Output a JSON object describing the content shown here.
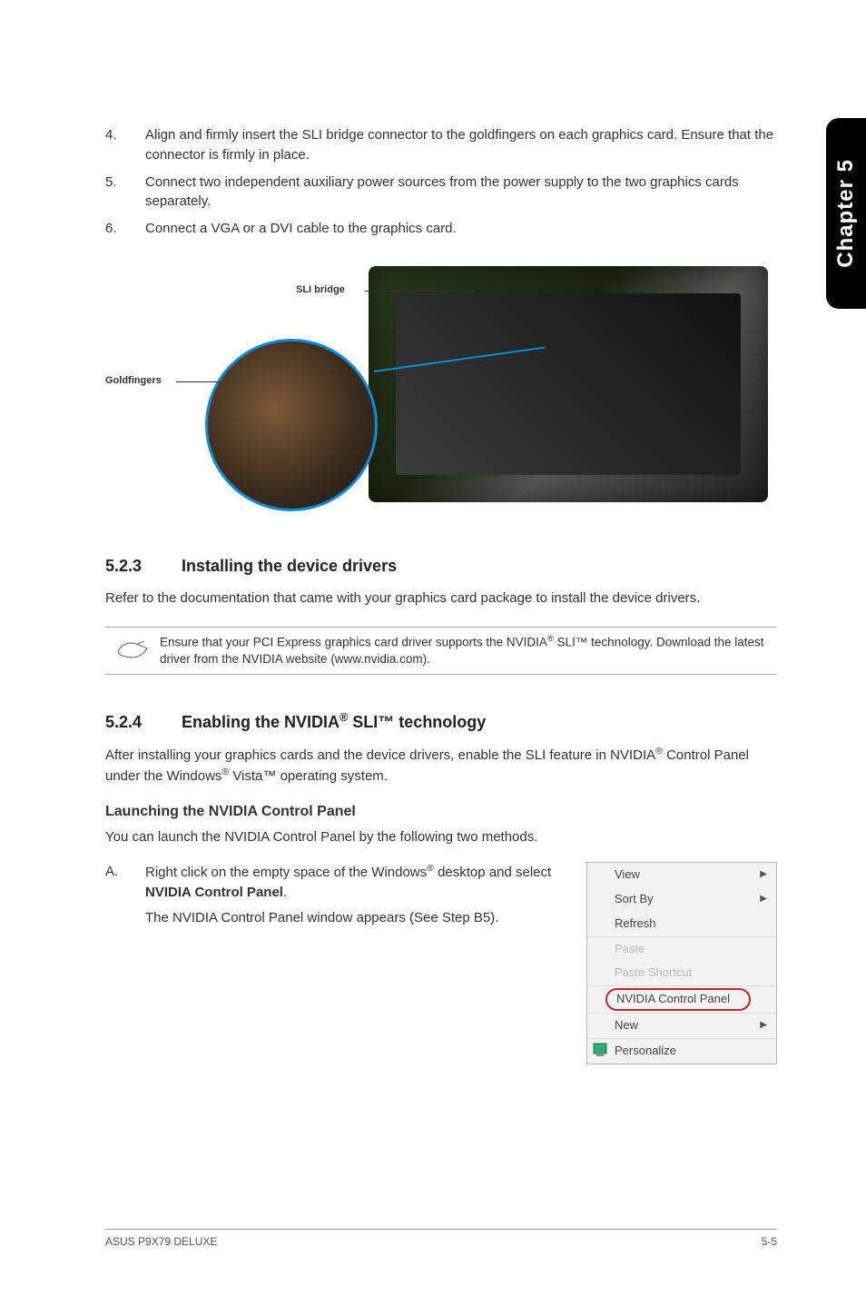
{
  "sideTab": "Chapter 5",
  "steps": [
    {
      "num": "4.",
      "text": "Align and firmly insert the SLI bridge connector to the goldfingers on each graphics card. Ensure that the connector is firmly in place."
    },
    {
      "num": "5.",
      "text": "Connect two independent auxiliary power sources from the power supply to the two graphics cards separately."
    },
    {
      "num": "6.",
      "text": "Connect a VGA or a DVI cable to the graphics card."
    }
  ],
  "figure": {
    "sliLabel": "SLI bridge",
    "goldLabel": "Goldfingers"
  },
  "section523": {
    "num": "5.2.3",
    "title": "Installing the device drivers",
    "body": "Refer to the documentation that came with your graphics card package to install the device drivers.",
    "note_a": "Ensure that your PCI Express graphics card driver supports the NVIDIA",
    "note_b": " SLI™ technology. Download the latest driver from the NVIDIA website (www.nvidia.com)."
  },
  "section524": {
    "num": "5.2.4",
    "title_a": "Enabling the NVIDIA",
    "title_b": " SLI™ technology",
    "body_a": "After installing your graphics cards and the device drivers, enable the SLI feature in NVIDIA",
    "body_b": " Control Panel under the Windows",
    "body_c": " Vista™ operating system.",
    "subheading": "Launching the NVIDIA Control Panel",
    "subbody": "You can launch the NVIDIA Control Panel by the following two methods.",
    "stepA": {
      "letter": "A.",
      "line1_a": "Right click on the empty space of the Windows",
      "line1_b": " desktop and select ",
      "line1_bold": "NVIDIA Control Panel",
      "line1_c": ".",
      "line2": "The NVIDIA Control Panel window appears (See Step B5)."
    }
  },
  "contextMenu": {
    "view": "View",
    "sortBy": "Sort By",
    "refresh": "Refresh",
    "paste": "Paste",
    "pasteShortcut": "Paste Shortcut",
    "nvidia": "NVIDIA Control Panel",
    "new": "New",
    "personalize": "Personalize"
  },
  "footer": {
    "left": "ASUS P9X79 DELUXE",
    "right": "5-5"
  }
}
